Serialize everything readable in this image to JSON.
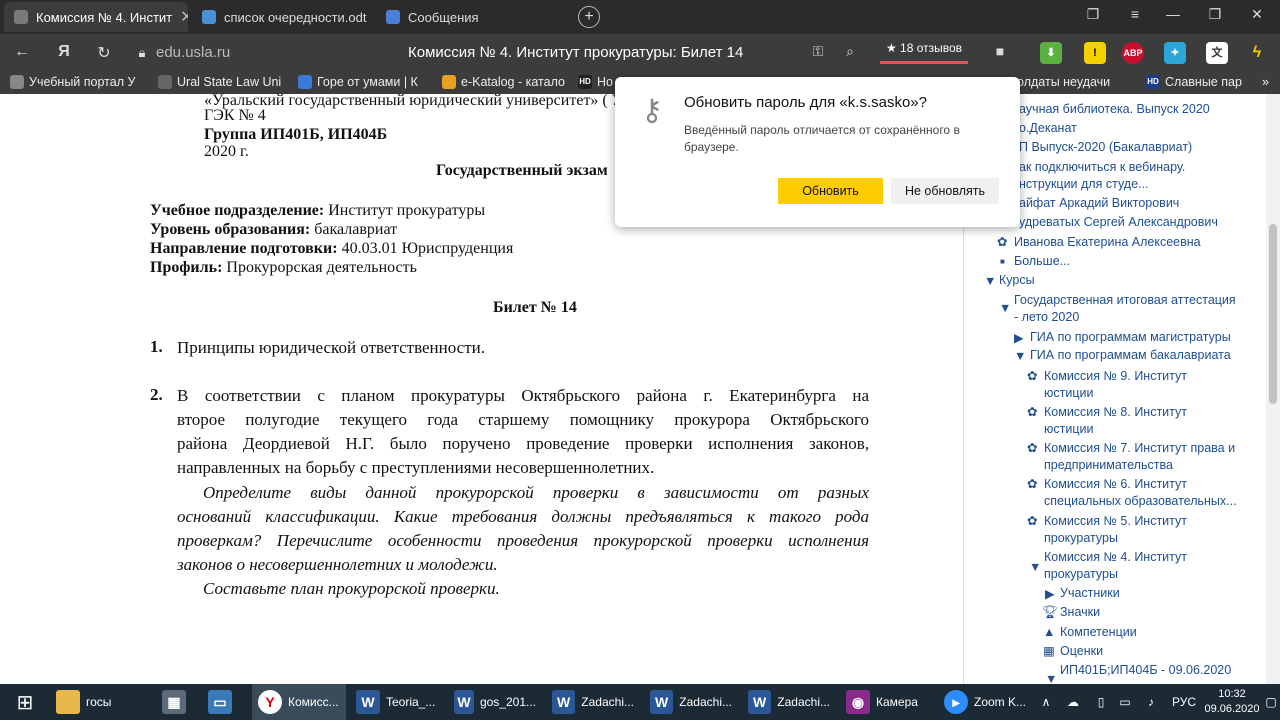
{
  "tabs": [
    {
      "title": "Комиссия № 4. Инстит",
      "active": true,
      "close": "✕"
    },
    {
      "title": "список очередности.odt",
      "active": false
    },
    {
      "title": "Сообщения",
      "active": false
    }
  ],
  "toolbar": {
    "url": "edu.usla.ru",
    "page_title": "Комиссия № 4. Институт прокуратуры: Билет 14",
    "reviews": "★ 18 отзывов",
    "abp_label": "ABP"
  },
  "bookmarks": [
    "Учебный портал У",
    "Ural State Law Uni",
    "Горе от умами | К",
    "e-Katalog - катало",
    "Но",
    "Солдаты неудачи",
    "Славные пар"
  ],
  "document": {
    "header_lines": [
      "«Уральский государственный юридический университет» ( Ур",
      "ГЭК № 4",
      "Группа ИП401Б, ИП404Б",
      "2020 г."
    ],
    "exam_title": "Государственный экзам",
    "fields": [
      {
        "label": "Учебное подразделение:",
        "value": " Институт прокуратуры"
      },
      {
        "label": "Уровень образования:",
        "value": " бакалавриат"
      },
      {
        "label": "Направление подготовки:",
        "value": " 40.03.01 Юриспруденция"
      },
      {
        "label": "Профиль:",
        "value": " Прокурорская деятельность"
      }
    ],
    "ticket_title": "Билет № 14",
    "q1_num": "1.",
    "q1_text": "Принципы юридической ответственности.",
    "q2_num": "2.",
    "q2_lines": [
      "В соответствии с планом прокуратуры Октябрьского района г. Екатеринбурга на",
      "второе полугодие текущего года старшему помощнику прокурора Октябрьского",
      "района Деордиевой Н.Г. было поручено проведение проверки исполнения законов,",
      "направленных на борьбу с преступлениями несовершеннолетних."
    ],
    "task_lines": [
      "Определите виды данной прокурорской проверки в зависимости от разных",
      "оснований классификации. Какие требования должны предъявляться к такого рода",
      "проверкам? Перечислите особенности проведения прокурорской проверки исполнения",
      "законов о несовершеннолетних и молодежи."
    ],
    "task_last": "Составьте план прокурорской проверки."
  },
  "sidebar": {
    "items": [
      "аучная библиотека. Выпуск 2020",
      "о.Деканат",
      "П Выпуск-2020 (Бакалавриат)",
      "ак подключиться к вебинару.",
      "нструкции для студе...",
      "айфат Аркадий Викторович",
      "удреватых Сергей Александрович",
      "Иванова Екатерина Алексеевна",
      "Больше...",
      "Курсы",
      "Государственная итоговая аттестация",
      "- лето 2020",
      "ГИА по программам магистратуры",
      "ГИА по программам бакалавриата",
      "Комиссия № 9. Институт",
      "юстиции",
      "Комиссия № 8. Институт",
      "юстиции",
      "Комиссия № 7. Институт права и",
      "предпринимательства",
      "Комиссия № 6. Институт",
      "специальных образовательных...",
      "Комиссия № 5. Институт",
      "прокуратуры",
      "Комиссия № 4. Институт",
      "прокуратуры",
      "Участники",
      "Значки",
      "Компетенции",
      "Оценки",
      "ИП401Б;ИП404Б - 09.06.2020"
    ]
  },
  "popup": {
    "title": "Обновить пароль для «k.s.sasko»?",
    "message": "Введённый пароль отличается от сохранённого в браузере.",
    "update_label": "Обновить",
    "no_update_label": "Не обновлять"
  },
  "taskbar": {
    "items": [
      "госы",
      "Комисс...",
      "Teoria_...",
      "gos_201...",
      "Zadachi...",
      "Zadachi...",
      "Zadachi...",
      "Камера",
      "Zoom K..."
    ],
    "lang": "РУС",
    "time": "10:32",
    "date": "09.06.2020"
  },
  "colors": {
    "accent_yellow": "#ffcc00",
    "link_blue": "#1f4e94",
    "taskbar": "#1c2a36"
  }
}
